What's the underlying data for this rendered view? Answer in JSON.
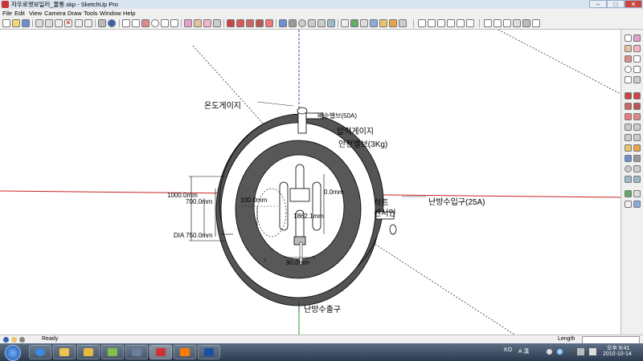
{
  "window": {
    "title": "자우로켓보일러_물통.skp - SketchUp Pro",
    "buttons": [
      "–",
      "□",
      "✕"
    ]
  },
  "menu": [
    "File",
    "Edit",
    "View",
    "Camera",
    "Draw",
    "Tools",
    "Window",
    "Help"
  ],
  "labels": {
    "temp_gauge": "온도게이지",
    "valve_50a": "배수밸브(50A)",
    "pressure_gauge": "압력게이지",
    "safety_valve": "안전밸브(3Kg)",
    "heater_a": "히트",
    "heater_b": "센서인",
    "inlet": "난방수입구(25A)",
    "outlet": "난방수출구"
  },
  "dimensions": {
    "d1000": "1000.0mm",
    "d700": "700.0mm",
    "dia750": "DIA 750.0mm",
    "d100": "100.0mm",
    "d_right": "0.0mm",
    "d_center": "1862.1mm",
    "d90": "90.0mm"
  },
  "status": {
    "ready": "Ready",
    "length_label": "Length"
  },
  "taskbar": {
    "lang": "KO",
    "ime": "A 漢",
    "time": "오후 9:41",
    "date": "2010-10-14"
  },
  "colors": {
    "tank_outer": "#545454",
    "tank_rim": "#ffffff",
    "axis_red": "#cc2222",
    "axis_green": "#2e9a2e",
    "axis_blue": "#2050c0"
  }
}
